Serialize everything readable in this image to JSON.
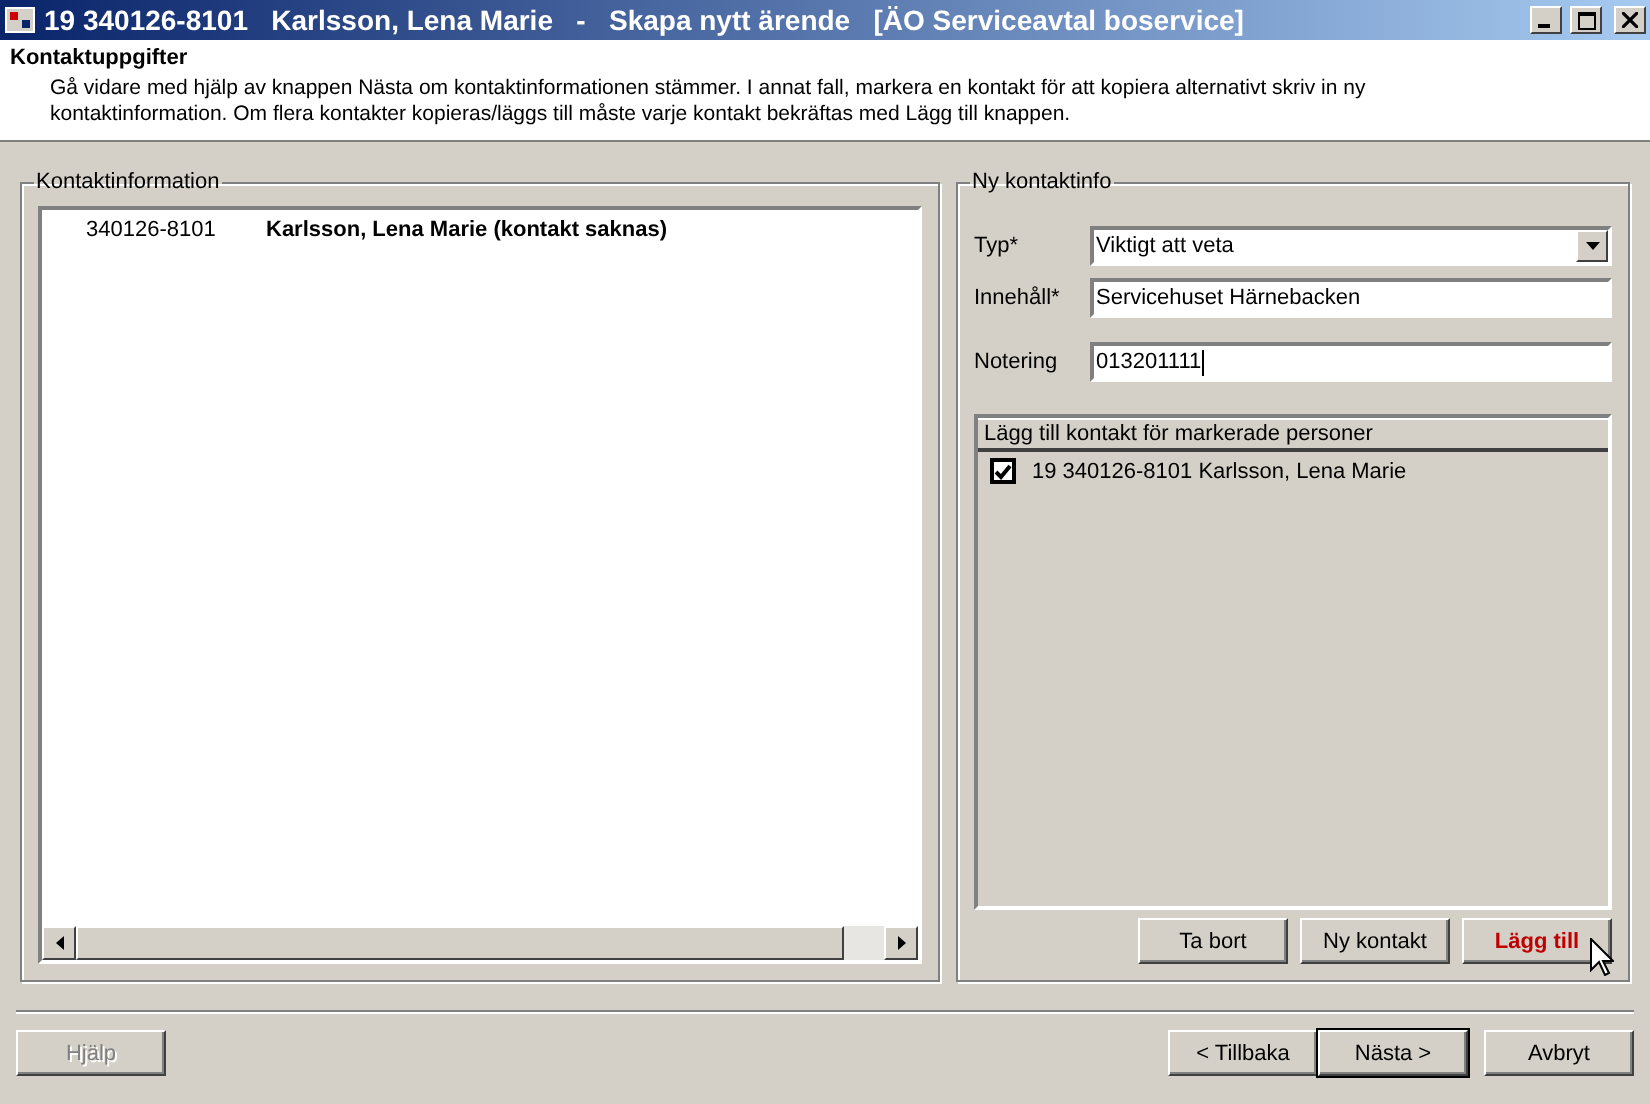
{
  "window": {
    "title": "19 340126-8101   Karlsson, Lena Marie   -   Skapa nytt ärende   [ÄO Serviceavtal boservice]"
  },
  "header": {
    "title": "Kontaktuppgifter",
    "description": "Gå vidare med hjälp av knappen Nästa om kontaktinformationen stämmer. I annat fall, markera en kontakt för att kopiera alternativt skriv in ny kontaktinformation. Om flera kontakter kopieras/läggs till måste varje kontakt bekräftas med Lägg till knappen."
  },
  "contact_info": {
    "legend": "Kontaktinformation",
    "rows": [
      {
        "id_number": "340126-8101",
        "name": "Karlsson, Lena Marie (kontakt saknas)"
      }
    ]
  },
  "new_contact": {
    "legend": "Ny kontaktinfo",
    "type": {
      "label": "Typ*",
      "value": "Viktigt att veta"
    },
    "content": {
      "label": "Innehåll*",
      "value": "Servicehuset Härnebacken"
    },
    "note": {
      "label": "Notering",
      "value": "013201111"
    },
    "persons": {
      "header": "Lägg till kontakt för markerade personer",
      "rows": [
        {
          "label": "19 340126-8101  Karlsson, Lena Marie",
          "checked": true
        }
      ]
    },
    "buttons": [
      {
        "label": "Ta bort",
        "hover": false
      },
      {
        "label": "Ny kontakt",
        "hover": false
      },
      {
        "label": "Lägg till",
        "hover": true
      }
    ]
  },
  "footer": {
    "buttons": [
      {
        "label": "Hjälp",
        "disabled": true,
        "default": false
      },
      {
        "label": "< Tillbaka",
        "disabled": false,
        "default": false
      },
      {
        "label": "Nästa >",
        "disabled": false,
        "default": true
      },
      {
        "label": "Avbryt",
        "disabled": false,
        "default": false
      }
    ]
  }
}
